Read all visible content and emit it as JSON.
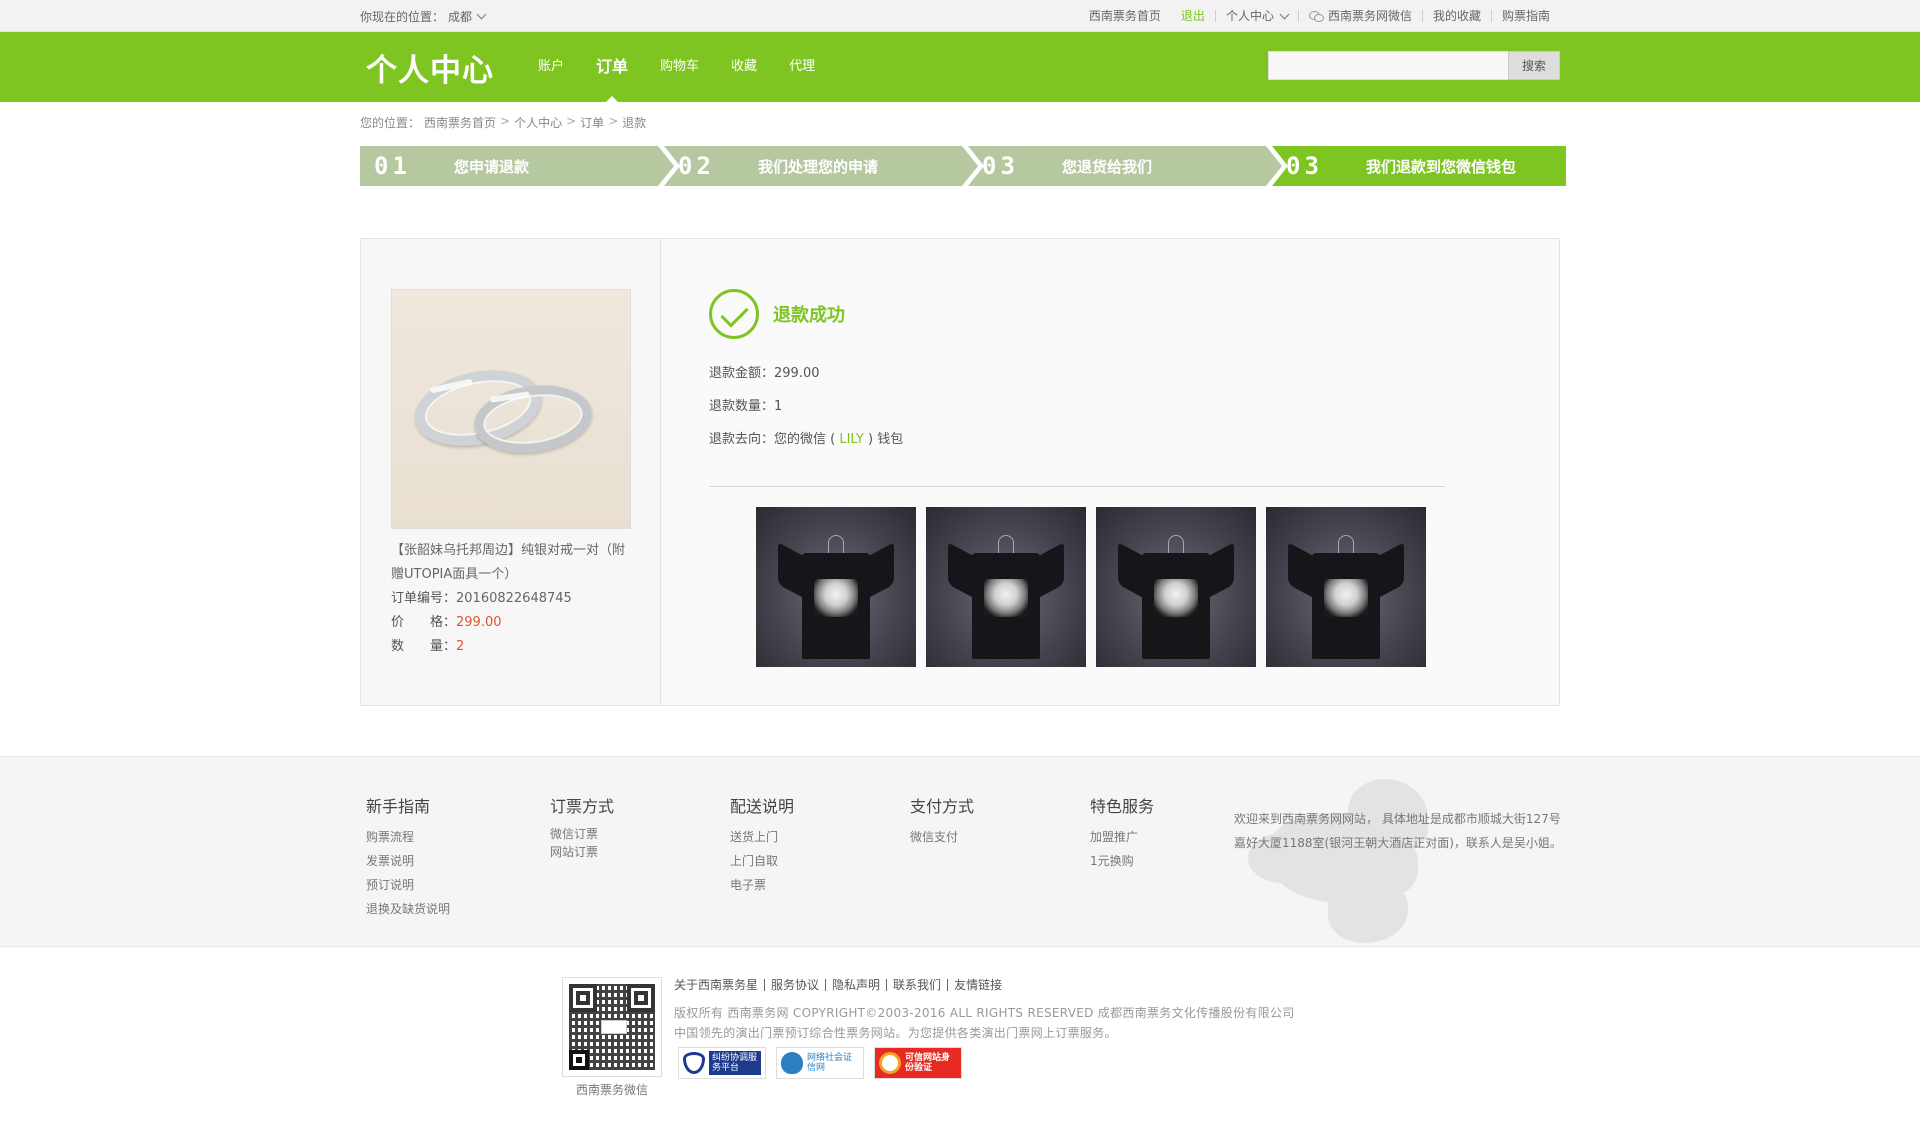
{
  "topbar": {
    "location_prefix": "你现在的位置：",
    "location_city": "成都",
    "links": [
      {
        "label": "西南票务首页"
      },
      {
        "label": "退出"
      },
      {
        "label": "个人中心"
      },
      {
        "label": "西南票务网微信"
      },
      {
        "label": "我的收藏"
      },
      {
        "label": "购票指南"
      }
    ]
  },
  "header": {
    "logo": "个人中心",
    "nav": [
      {
        "label": "账户"
      },
      {
        "label": "订单"
      },
      {
        "label": "购物车"
      },
      {
        "label": "收藏"
      },
      {
        "label": "代理"
      }
    ],
    "search_placeholder": "",
    "search_button": "搜索"
  },
  "breadcrumb": {
    "prefix": "您的位置：",
    "items": [
      "西南票务首页",
      "个人中心",
      "订单",
      "退款"
    ]
  },
  "steps": [
    {
      "num": "01",
      "label": "您申请退款"
    },
    {
      "num": "02",
      "label": "我们处理您的申请"
    },
    {
      "num": "03",
      "label": "您退货给我们"
    },
    {
      "num": "03",
      "label": "我们退款到您微信钱包"
    }
  ],
  "product": {
    "title": "【张韶妹乌托邦周边】纯银对戒一对（附赠UTOPIA面具一个）",
    "order_label": "订单编号：",
    "order_no": "20160822648745",
    "price_label": "价　　格：",
    "price": "299.00",
    "qty_label": "数　　量：",
    "qty": "2"
  },
  "refund": {
    "status": "退款成功",
    "amount_label": "退款金额：",
    "amount": "299.00",
    "qty_label": "退款数量：",
    "qty": "1",
    "dest_prefix": "退款去向：您的微信 ( ",
    "dest_name": "LILY",
    "dest_suffix": " ) 钱包"
  },
  "footer": {
    "columns": [
      {
        "title": "新手指南",
        "links": [
          "购票流程",
          "发票说明",
          "预订说明",
          "退换及缺货说明"
        ]
      },
      {
        "title": "订票方式",
        "links": [
          "微信订票",
          "网站订票"
        ]
      },
      {
        "title": "配送说明",
        "links": [
          "送货上门",
          "上门自取",
          "电子票"
        ]
      },
      {
        "title": "支付方式",
        "links": [
          "微信支付"
        ]
      },
      {
        "title": "特色服务",
        "links": [
          "加盟推广",
          "1元换购"
        ]
      }
    ],
    "description": "欢迎来到西南票务网网站， 具体地址是成都市顺城大街127号嘉好大厦1188室(银河王朝大酒店正对面)，联系人是吴小姐。",
    "qr_caption": "西南票务微信",
    "bottom_links": [
      "关于西南票务星",
      "服务协议",
      "隐私声明",
      "联系我们",
      "友情链接"
    ],
    "copyright": "版权所有 西南票务网 COPYRIGHT©2003-2016 ALL RIGHTS RESERVED 成都西南票务文化传播股份有限公司",
    "slogan": "中国领先的演出门票预订综合性票务网站。为您提供各类演出门票网上订票服务。",
    "badges": [
      {
        "text": "纠纷协调服务平台"
      },
      {
        "text": "网络社会证信网"
      },
      {
        "text": "可信网站身份验证"
      }
    ]
  },
  "colors": {
    "brand": "#7ec521",
    "step_inactive": "#b6c8a0",
    "price_red": "#e0532f"
  }
}
